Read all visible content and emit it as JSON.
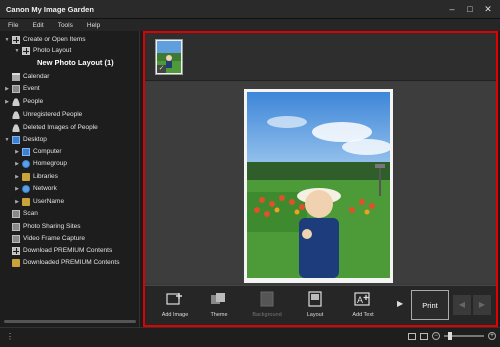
{
  "window": {
    "title": "Canon My Image Garden",
    "controls": [
      "–",
      "□",
      "✕"
    ]
  },
  "menu": [
    "File",
    "Edit",
    "Tools",
    "Help"
  ],
  "sidebar": {
    "items": [
      {
        "label": "Create or Open Items",
        "icon": "create-items-icon",
        "arrow": "▼"
      },
      {
        "label": "Photo Layout",
        "icon": "photo-layout-icon",
        "arrow": "▼"
      },
      {
        "label": "New Photo Layout (1)",
        "icon": "",
        "arrow": ""
      },
      {
        "label": "Calendar",
        "icon": "calendar-icon",
        "arrow": ""
      },
      {
        "label": "Event",
        "icon": "event-icon",
        "arrow": "▶"
      },
      {
        "label": "People",
        "icon": "people-icon",
        "arrow": "▶"
      },
      {
        "label": "Unregistered People",
        "icon": "unregistered-people-icon",
        "arrow": ""
      },
      {
        "label": "Deleted Images of People",
        "icon": "deleted-people-icon",
        "arrow": ""
      },
      {
        "label": "Desktop",
        "icon": "desktop-icon",
        "arrow": "▼"
      },
      {
        "label": "Computer",
        "icon": "computer-icon",
        "arrow": "▶"
      },
      {
        "label": "Homegroup",
        "icon": "homegroup-icon",
        "arrow": "▶"
      },
      {
        "label": "Libraries",
        "icon": "libraries-icon",
        "arrow": "▶"
      },
      {
        "label": "Network",
        "icon": "network-icon",
        "arrow": "▶"
      },
      {
        "label": "UserName",
        "icon": "user-folder-icon",
        "arrow": "▶"
      },
      {
        "label": "Scan",
        "icon": "scan-icon",
        "arrow": ""
      },
      {
        "label": "Photo Sharing Sites",
        "icon": "photo-sharing-icon",
        "arrow": ""
      },
      {
        "label": "Video Frame Capture",
        "icon": "video-frame-icon",
        "arrow": ""
      },
      {
        "label": "Download PREMIUM Contents",
        "icon": "download-premium-icon",
        "arrow": ""
      },
      {
        "label": "Downloaded PREMIUM Contents",
        "icon": "downloaded-premium-icon",
        "arrow": ""
      }
    ]
  },
  "toolbar": {
    "add_image": "Add Image",
    "theme": "Theme",
    "background": "Background",
    "layout": "Layout",
    "add_text": "Add Text",
    "print": "Print",
    "next": "▶",
    "prev_nav": "◀",
    "next_nav": "▶"
  },
  "status": {
    "menu_glyph": "⋮"
  },
  "colors": {
    "highlight_border": "#e00000",
    "background": "#1b1b1b"
  }
}
